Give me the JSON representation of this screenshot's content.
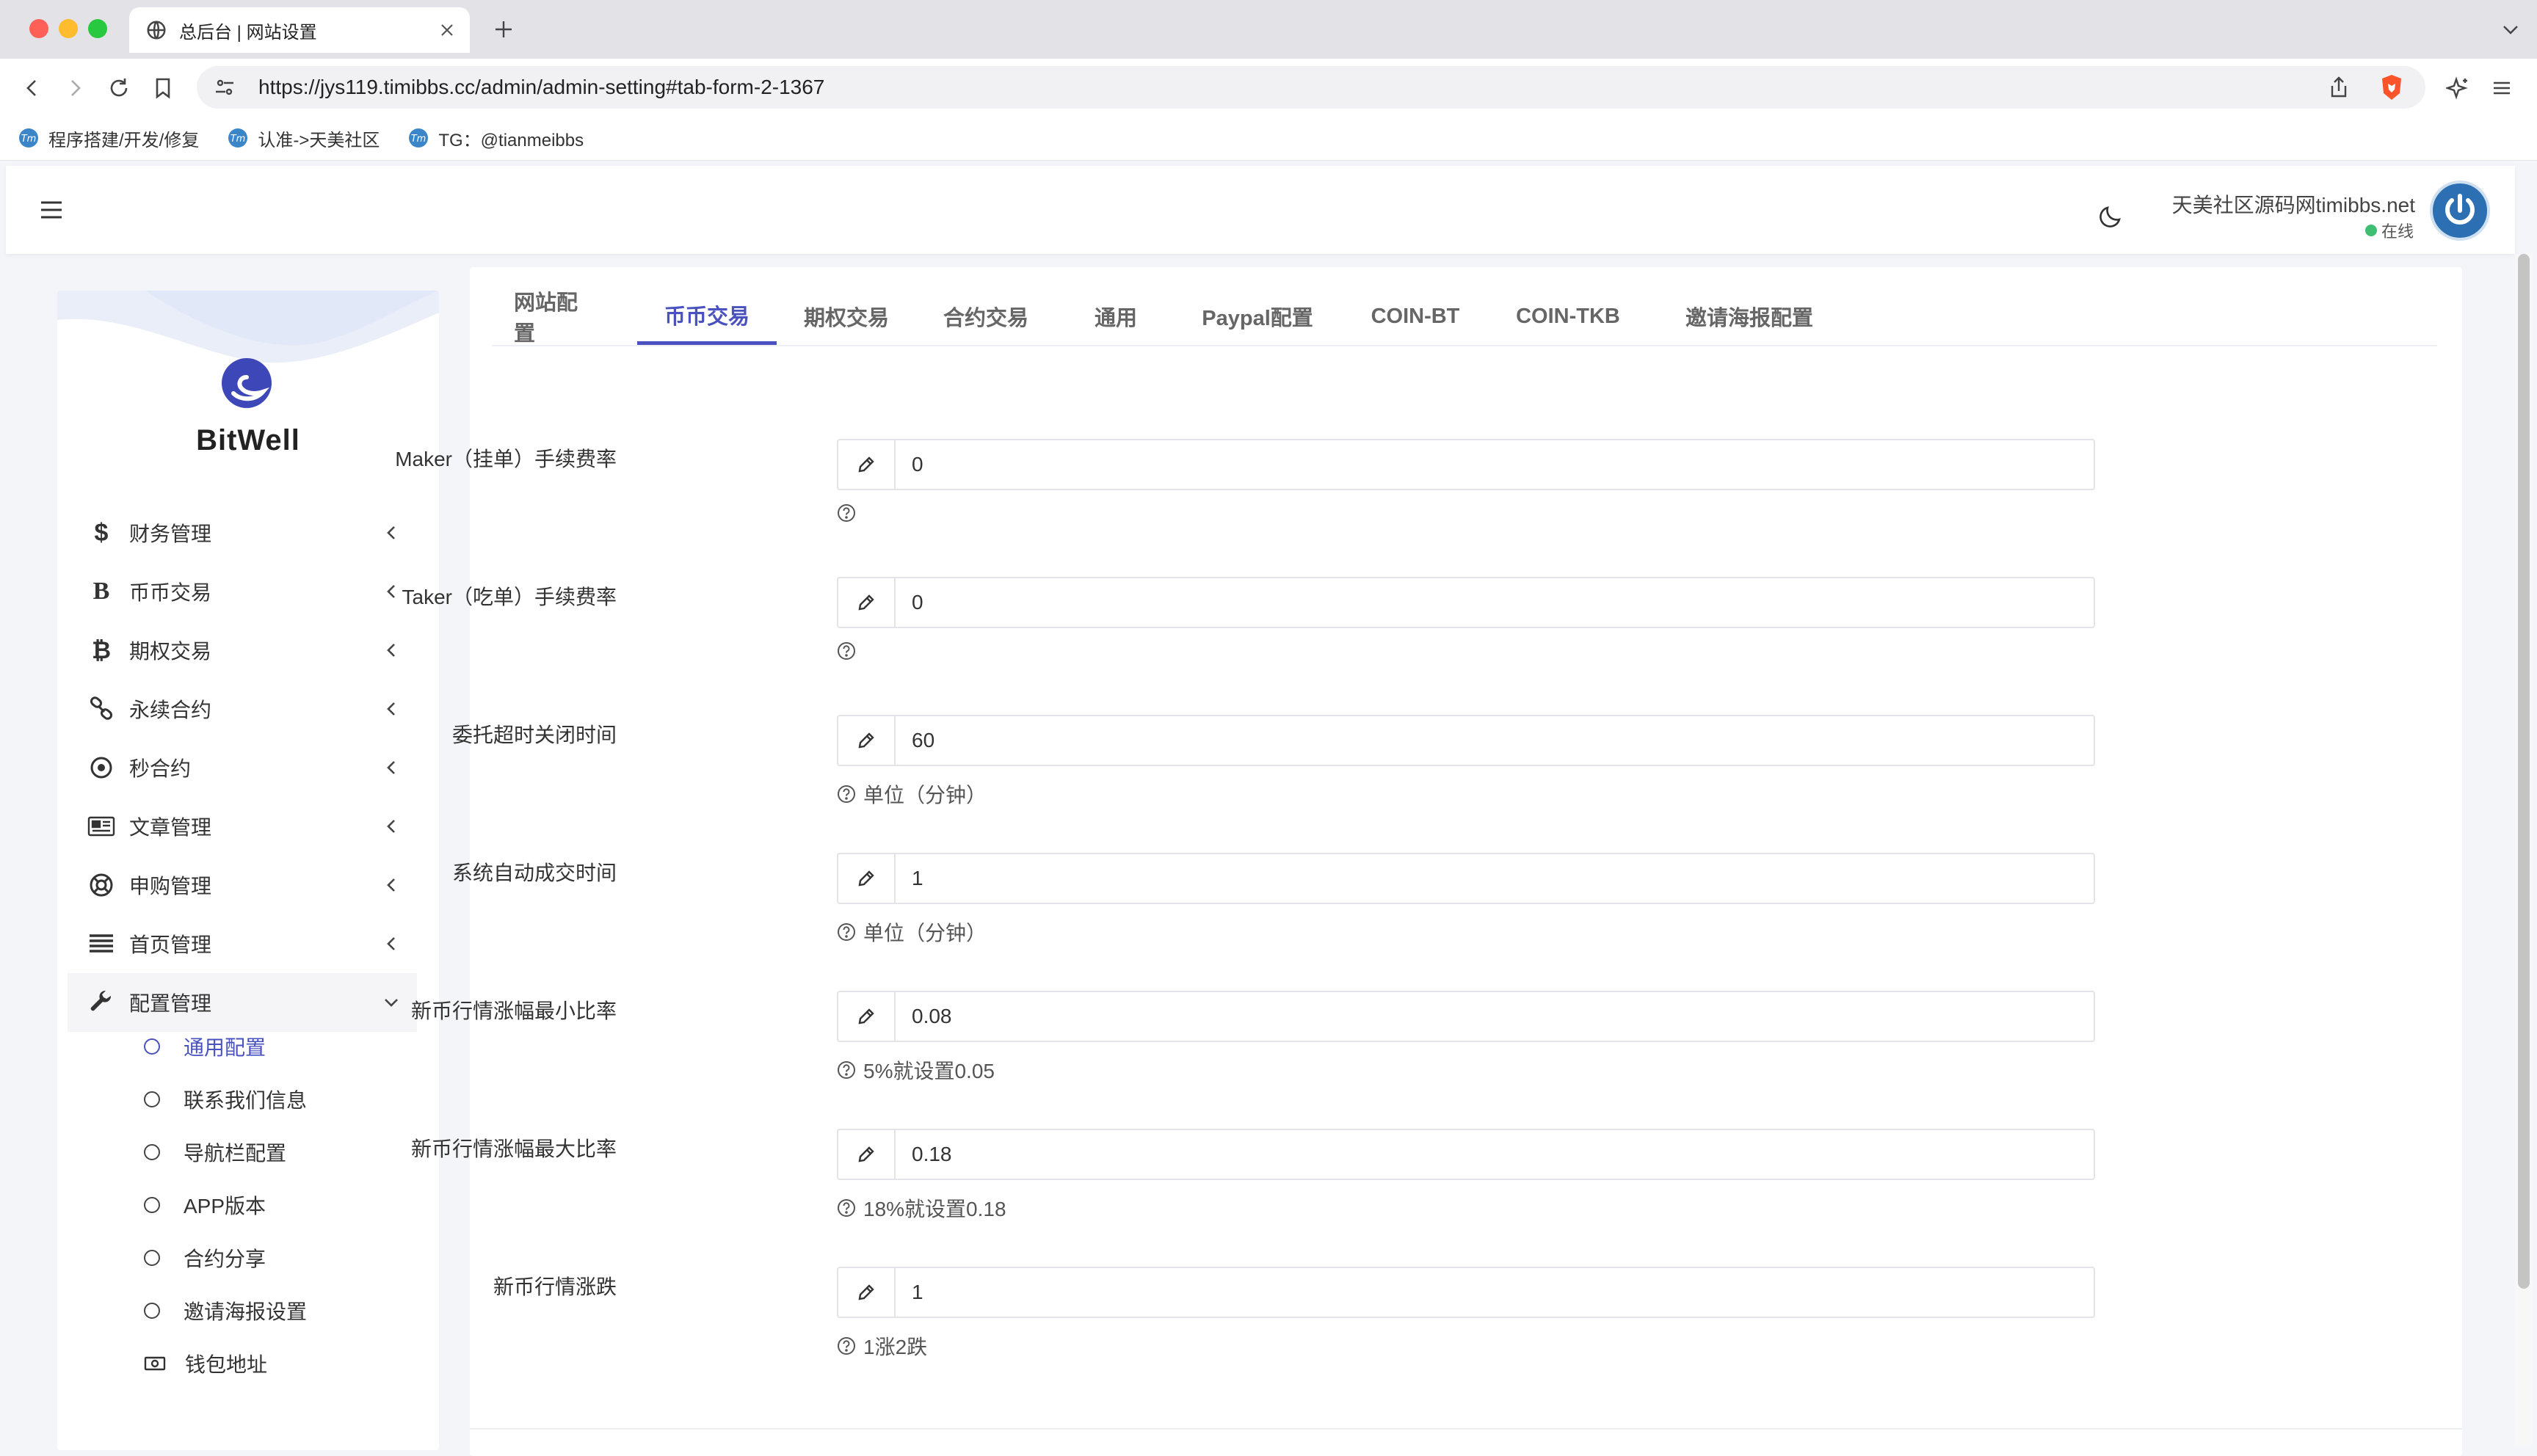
{
  "browser": {
    "tab_title": "总后台 | 网站设置",
    "url": "https://jys119.timibbs.cc/admin/admin-setting#tab-form-2-1367",
    "bookmarks": [
      {
        "label": "程序搭建/开发/修复"
      },
      {
        "label": "认准->天美社区"
      },
      {
        "label": "TG：@tianmeibbs"
      }
    ]
  },
  "header": {
    "user_name": "天美社区源码网timibbs.net",
    "status": "在线"
  },
  "sidebar": {
    "brand": "BitWell",
    "menu": [
      {
        "label": "财务管理",
        "icon": "dollar-icon"
      },
      {
        "label": "币币交易",
        "icon": "letter-b-icon"
      },
      {
        "label": "期权交易",
        "icon": "bitcoin-icon"
      },
      {
        "label": "永续合约",
        "icon": "link-icon"
      },
      {
        "label": "秒合约",
        "icon": "target-icon"
      },
      {
        "label": "文章管理",
        "icon": "newspaper-icon"
      },
      {
        "label": "申购管理",
        "icon": "lifebuoy-icon"
      },
      {
        "label": "首页管理",
        "icon": "list-icon"
      },
      {
        "label": "配置管理",
        "icon": "wrench-icon"
      }
    ],
    "submenu": [
      {
        "label": "通用配置"
      },
      {
        "label": "联系我们信息"
      },
      {
        "label": "导航栏配置"
      },
      {
        "label": "APP版本"
      },
      {
        "label": "合约分享"
      },
      {
        "label": "邀请海报设置"
      },
      {
        "label": "钱包地址"
      }
    ]
  },
  "tabs": [
    {
      "label": "网站配置"
    },
    {
      "label": "币币交易"
    },
    {
      "label": "期权交易"
    },
    {
      "label": "合约交易"
    },
    {
      "label": "通用"
    },
    {
      "label": "Paypal配置"
    },
    {
      "label": "COIN-BT"
    },
    {
      "label": "COIN-TKB"
    },
    {
      "label": "邀请海报配置"
    }
  ],
  "form": [
    {
      "label": "Maker（挂单）手续费率",
      "value": "0",
      "help": ""
    },
    {
      "label": "Taker（吃单）手续费率",
      "value": "0",
      "help": ""
    },
    {
      "label": "委托超时关闭时间",
      "value": "60",
      "help": "单位（分钟）"
    },
    {
      "label": "系统自动成交时间",
      "value": "1",
      "help": "单位（分钟）"
    },
    {
      "label": "新币行情涨幅最小比率",
      "value": "0.08",
      "help": "5%就设置0.05"
    },
    {
      "label": "新币行情涨幅最大比率",
      "value": "0.18",
      "help": "18%就设置0.18"
    },
    {
      "label": "新币行情涨跌",
      "value": "1",
      "help": "1涨2跌"
    }
  ],
  "colors": {
    "accent": "#4a52c0",
    "online": "#3ebd73"
  }
}
